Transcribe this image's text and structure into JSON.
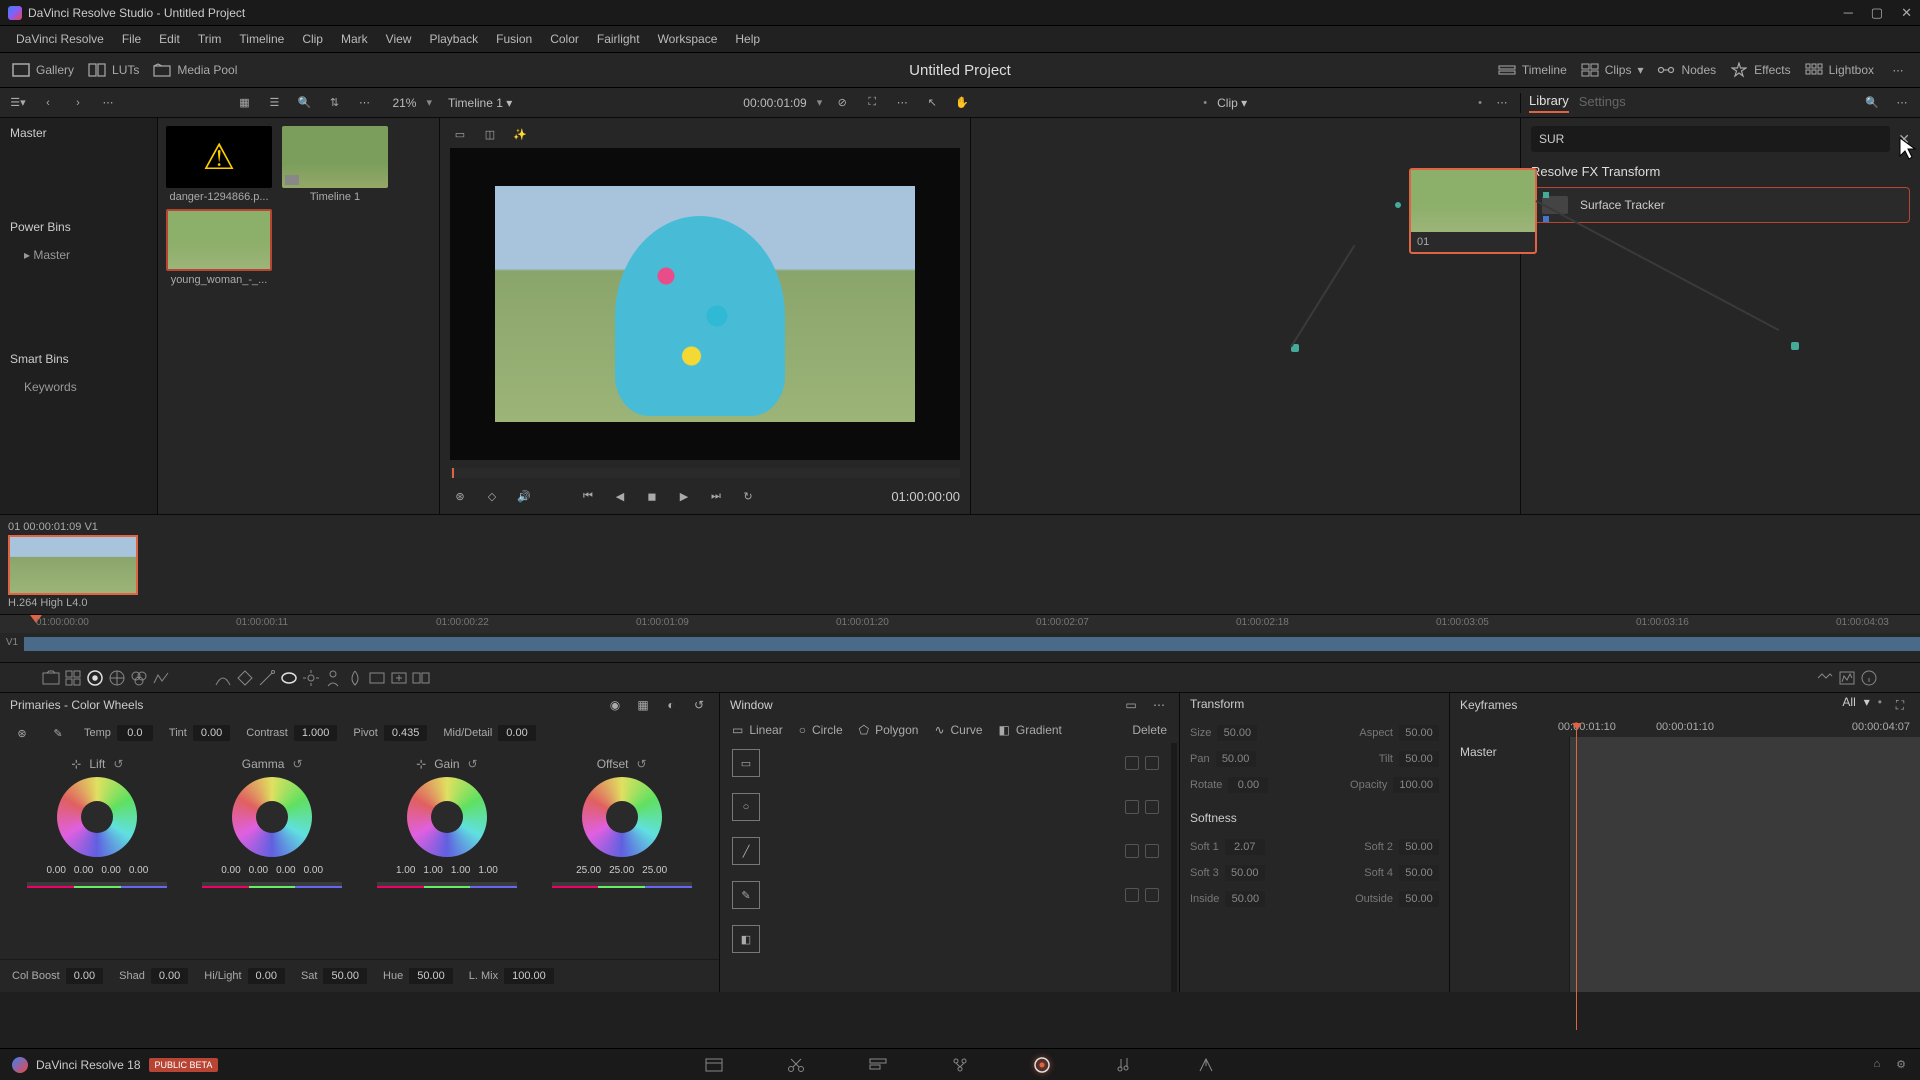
{
  "app": {
    "title": "DaVinci Resolve Studio - Untitled Project"
  },
  "menus": [
    "DaVinci Resolve",
    "File",
    "Edit",
    "Trim",
    "Timeline",
    "Clip",
    "Mark",
    "View",
    "Playback",
    "Fusion",
    "Color",
    "Fairlight",
    "Workspace",
    "Help"
  ],
  "toolbar": {
    "left": [
      {
        "name": "gallery",
        "label": "Gallery"
      },
      {
        "name": "luts",
        "label": "LUTs"
      },
      {
        "name": "media-pool",
        "label": "Media Pool"
      }
    ],
    "project_title": "Untitled Project",
    "right": [
      {
        "name": "timeline",
        "label": "Timeline"
      },
      {
        "name": "clips",
        "label": "Clips"
      },
      {
        "name": "nodes",
        "label": "Nodes"
      },
      {
        "name": "effects",
        "label": "Effects"
      },
      {
        "name": "lightbox",
        "label": "Lightbox"
      }
    ]
  },
  "subbar": {
    "zoom": "21%",
    "timeline_name": "Timeline 1",
    "timecode": "00:00:01:09",
    "clip_label": "Clip",
    "tabs": {
      "library": "Library",
      "settings": "Settings"
    }
  },
  "media": {
    "master": "Master",
    "power_bins": "Power Bins",
    "power_master": "Master",
    "smart_bins": "Smart Bins",
    "keywords": "Keywords",
    "thumbs": [
      {
        "name": "danger",
        "label": "danger-1294866.p..."
      },
      {
        "name": "timeline1",
        "label": "Timeline 1"
      },
      {
        "name": "clip",
        "label": "young_woman_-_..."
      }
    ]
  },
  "viewer": {
    "tc": "01:00:00:00"
  },
  "node": {
    "label": "01"
  },
  "library": {
    "search": "SUR",
    "category": "Resolve FX Transform",
    "item": "Surface Tracker"
  },
  "clipstrip": {
    "header": "01   00:00:01:09    V1",
    "codec": "H.264 High L4.0"
  },
  "minitimeline": {
    "track": "V1",
    "ticks": [
      "01:00:00:00",
      "01:00:00:11",
      "01:00:00:22",
      "01:00:01:09",
      "01:00:01:20",
      "01:00:02:07",
      "01:00:02:18",
      "01:00:03:05",
      "01:00:03:16",
      "01:00:04:03"
    ]
  },
  "primaries": {
    "title": "Primaries - Color Wheels",
    "adjust_top": [
      {
        "lab": "Temp",
        "val": "0.0"
      },
      {
        "lab": "Tint",
        "val": "0.00"
      },
      {
        "lab": "Contrast",
        "val": "1.000"
      },
      {
        "lab": "Pivot",
        "val": "0.435"
      },
      {
        "lab": "Mid/Detail",
        "val": "0.00"
      }
    ],
    "wheels": [
      {
        "name": "Lift",
        "vals": [
          "0.00",
          "0.00",
          "0.00",
          "0.00"
        ]
      },
      {
        "name": "Gamma",
        "vals": [
          "0.00",
          "0.00",
          "0.00",
          "0.00"
        ]
      },
      {
        "name": "Gain",
        "vals": [
          "1.00",
          "1.00",
          "1.00",
          "1.00"
        ]
      },
      {
        "name": "Offset",
        "vals": [
          "25.00",
          "25.00",
          "25.00"
        ]
      }
    ],
    "adjust_bot": [
      {
        "lab": "Col Boost",
        "val": "0.00"
      },
      {
        "lab": "Shad",
        "val": "0.00"
      },
      {
        "lab": "Hi/Light",
        "val": "0.00"
      },
      {
        "lab": "Sat",
        "val": "50.00"
      },
      {
        "lab": "Hue",
        "val": "50.00"
      },
      {
        "lab": "L. Mix",
        "val": "100.00"
      }
    ]
  },
  "window_panel": {
    "title": "Window",
    "tabs": [
      "Linear",
      "Circle",
      "Polygon",
      "Curve",
      "Gradient"
    ],
    "delete": "Delete"
  },
  "transform": {
    "title": "Transform",
    "rows": [
      [
        {
          "k": "Size",
          "v": "50.00"
        },
        {
          "k": "Aspect",
          "v": "50.00"
        }
      ],
      [
        {
          "k": "Pan",
          "v": "50.00"
        },
        {
          "k": "Tilt",
          "v": "50.00"
        }
      ],
      [
        {
          "k": "Rotate",
          "v": "0.00"
        },
        {
          "k": "Opacity",
          "v": "100.00"
        }
      ]
    ],
    "softness": "Softness",
    "soft_rows": [
      [
        {
          "k": "Soft 1",
          "v": "2.07"
        },
        {
          "k": "Soft 2",
          "v": "50.00"
        }
      ],
      [
        {
          "k": "Soft 3",
          "v": "50.00"
        },
        {
          "k": "Soft 4",
          "v": "50.00"
        }
      ],
      [
        {
          "k": "Inside",
          "v": "50.00"
        },
        {
          "k": "Outside",
          "v": "50.00"
        }
      ]
    ]
  },
  "keyframes": {
    "title": "Keyframes",
    "all": "All",
    "tc_start": "00:00:01:10",
    "tc_mid": "00:00:01:10",
    "tc_end": "00:00:04:07",
    "master": "Master"
  },
  "brand": {
    "name": "DaVinci Resolve 18",
    "beta": "PUBLIC BETA"
  }
}
